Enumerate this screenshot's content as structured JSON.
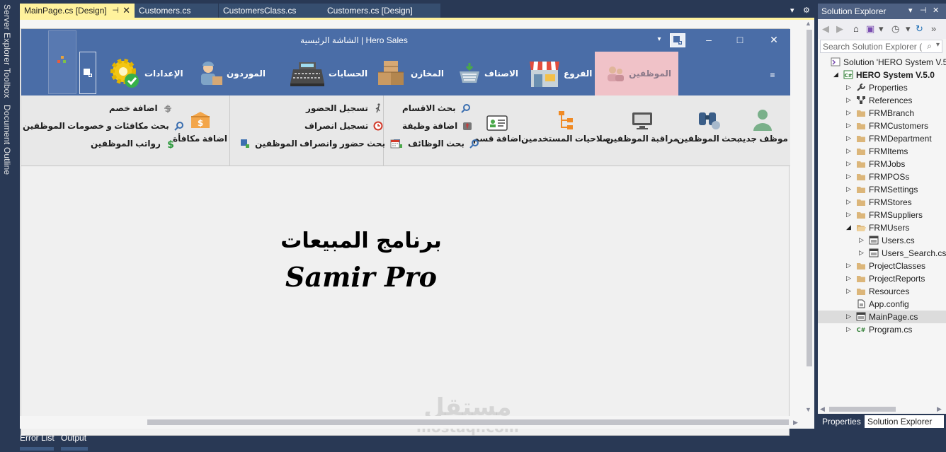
{
  "left_strip": [
    "Server Explorer",
    "Toolbox",
    "Document Outline"
  ],
  "doc_tabs": [
    {
      "label": "MainPage.cs [Design]",
      "active": true
    },
    {
      "label": "Customers.cs",
      "active": false
    },
    {
      "label": "CustomersClass.cs",
      "active": false
    },
    {
      "label": "Customers.cs [Design]",
      "active": false
    }
  ],
  "form": {
    "title": "Hero Sales  |  الشاشة الرئيسية",
    "nav": [
      {
        "label": "الموظفين",
        "icon": "employees-icon",
        "active": true
      },
      {
        "label": "الفروع",
        "icon": "store-icon"
      },
      {
        "label": "الاصناف",
        "icon": "basket-icon"
      },
      {
        "label": "المخازن",
        "icon": "boxes-icon"
      },
      {
        "label": "الحسابات",
        "icon": "cash-register-icon"
      },
      {
        "label": "الموردون",
        "icon": "supplier-icon"
      },
      {
        "label": "الإعدادات",
        "icon": "settings-gear-icon"
      }
    ],
    "ribbon": {
      "big_buttons": [
        {
          "label": "موظف جديد",
          "icon": "user-icon"
        },
        {
          "label": "بحث الموظفين",
          "icon": "binoculars-icon"
        },
        {
          "label": "مراقبة الموظفين",
          "icon": "monitor-icon"
        },
        {
          "label": "صلاحيات المستخدمين",
          "icon": "hierarchy-icon"
        },
        {
          "label": "اضافة قسم",
          "icon": "id-card-icon"
        },
        {
          "label": "اضافة مكافأة",
          "icon": "money-box-icon"
        }
      ],
      "group_jobs": [
        "بحث الاقسام",
        "اضافة وظيفة",
        "بحث الوظائف"
      ],
      "group_attendance": [
        "تسجيل الحضور",
        "تسجيل انصراف",
        "بحث حضور وانصراف الموظفين"
      ],
      "group_money": [
        "اضافة خصم",
        "بحث مكافئات و خصومات الموظفين",
        "رواتب الموظفين"
      ]
    },
    "main_title_ar": "برنامج المبيعات",
    "main_title_en": "Samir Pro"
  },
  "watermark": {
    "ar": "مستقل",
    "en": "mostaql.com"
  },
  "bottom_tabs": [
    "Error List",
    "Output"
  ],
  "solution_explorer": {
    "title": "Solution Explorer",
    "search_placeholder": "Search Solution Explorer (",
    "tree": [
      {
        "label": "Solution 'HERO System V.5",
        "level": 0,
        "icon": "solution-icon",
        "expander": ""
      },
      {
        "label": "HERO System V.5.0",
        "level": 1,
        "icon": "csharp-project-icon",
        "expander": "open",
        "bold": true
      },
      {
        "label": "Properties",
        "level": 2,
        "icon": "wrench-icon",
        "expander": "closed"
      },
      {
        "label": "References",
        "level": 2,
        "icon": "references-icon",
        "expander": "closed"
      },
      {
        "label": "FRMBranch",
        "level": 2,
        "icon": "folder-icon",
        "expander": "closed"
      },
      {
        "label": "FRMCustomers",
        "level": 2,
        "icon": "folder-icon",
        "expander": "closed"
      },
      {
        "label": "FRMDepartment",
        "level": 2,
        "icon": "folder-icon",
        "expander": "closed"
      },
      {
        "label": "FRMItems",
        "level": 2,
        "icon": "folder-icon",
        "expander": "closed"
      },
      {
        "label": "FRMJobs",
        "level": 2,
        "icon": "folder-icon",
        "expander": "closed"
      },
      {
        "label": "FRMPOSs",
        "level": 2,
        "icon": "folder-icon",
        "expander": "closed"
      },
      {
        "label": "FRMSettings",
        "level": 2,
        "icon": "folder-icon",
        "expander": "closed"
      },
      {
        "label": "FRMStores",
        "level": 2,
        "icon": "folder-icon",
        "expander": "closed"
      },
      {
        "label": "FRMSuppliers",
        "level": 2,
        "icon": "folder-icon",
        "expander": "closed"
      },
      {
        "label": "FRMUsers",
        "level": 2,
        "icon": "folder-open-icon",
        "expander": "open"
      },
      {
        "label": "Users.cs",
        "level": 3,
        "icon": "form-icon",
        "expander": "closed"
      },
      {
        "label": "Users_Search.cs",
        "level": 3,
        "icon": "form-icon",
        "expander": "closed"
      },
      {
        "label": "ProjectClasses",
        "level": 2,
        "icon": "folder-icon",
        "expander": "closed"
      },
      {
        "label": "ProjectReports",
        "level": 2,
        "icon": "folder-icon",
        "expander": "closed"
      },
      {
        "label": "Resources",
        "level": 2,
        "icon": "folder-icon",
        "expander": "closed"
      },
      {
        "label": "App.config",
        "level": 2,
        "icon": "config-icon",
        "expander": ""
      },
      {
        "label": "MainPage.cs",
        "level": 2,
        "icon": "form-icon",
        "expander": "closed",
        "selected": true
      },
      {
        "label": "Program.cs",
        "level": 2,
        "icon": "csharp-file-icon",
        "expander": "closed"
      }
    ],
    "bottom_tabs": [
      "Properties",
      "Solution Explorer"
    ]
  }
}
